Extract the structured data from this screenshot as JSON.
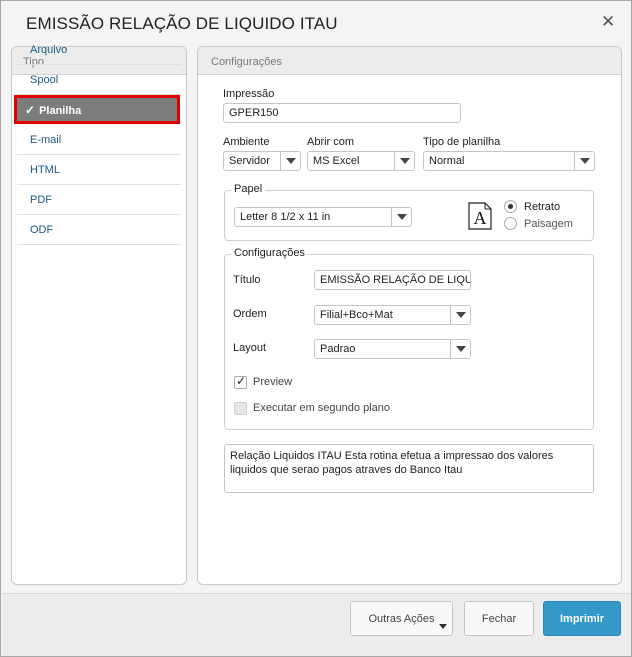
{
  "window": {
    "title": "EMISSÃO RELAÇÃO DE LIQUIDO ITAU",
    "close_icon": "close-icon"
  },
  "left_panel": {
    "header": "Tipo",
    "items": [
      {
        "label": "Arquivo"
      },
      {
        "label": "Spool"
      },
      {
        "label": "Planilha",
        "selected": true
      },
      {
        "label": "E-mail"
      },
      {
        "label": "HTML"
      },
      {
        "label": "PDF"
      },
      {
        "label": "ODF"
      }
    ],
    "selected_check": "✓"
  },
  "right_panel": {
    "header": "Configurações",
    "impressao": {
      "label": "Impressão",
      "value": "GPER150"
    },
    "ambiente": {
      "label": "Ambiente",
      "value": "Servidor"
    },
    "abrir_com": {
      "label": "Abrir com",
      "value": "MS Excel"
    },
    "tipo_planilha": {
      "label": "Tipo de planilha",
      "value": "Normal"
    },
    "papel": {
      "title": "Papel",
      "size": "Letter 8 1/2 x 11 in",
      "icon_glyph": "A",
      "orientation_options": [
        {
          "label": "Retrato",
          "selected": true
        },
        {
          "label": "Paisagem",
          "selected": false
        }
      ]
    },
    "config_group": {
      "title": "Configurações",
      "titulo": {
        "label": "Título",
        "value": "EMISSÃO RELAÇÃO DE LIQUIDO ITAU"
      },
      "ordem": {
        "label": "Ordem",
        "value": "Filial+Bco+Mat"
      },
      "layout": {
        "label": "Layout",
        "value": "Padrao"
      },
      "preview": {
        "label": "Preview",
        "checked": true
      },
      "background": {
        "label": "Executar em segundo plano",
        "checked": false,
        "disabled": true
      }
    },
    "description": "Relação Liquidos ITAU    Esta rotina efetua a impressao dos valores liquidos que serao pagos atraves do Banco Itau"
  },
  "footer": {
    "other_actions": "Outras Ações",
    "close": "Fechar",
    "print": "Imprimir"
  },
  "colors": {
    "primary": "#3498c9",
    "selection_border": "#e00000",
    "selection_bg": "#7c7c7c",
    "link": "#1a5a86"
  }
}
